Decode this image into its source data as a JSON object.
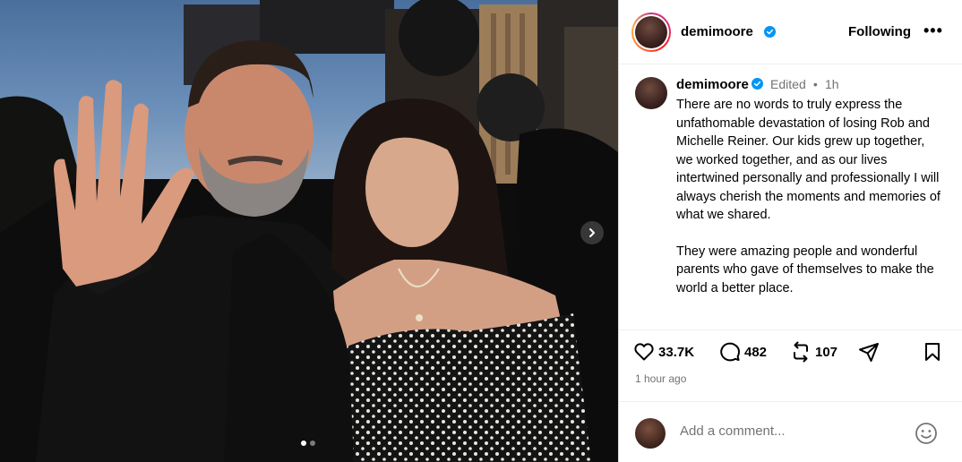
{
  "post": {
    "username": "demimoore",
    "follow_label": "Following",
    "more_label": "•••",
    "edited_label": "Edited",
    "separator": "•",
    "age_short": "1h",
    "caption_paragraphs": [
      "There are no words to truly express the unfathomable devastation of losing Rob and Michelle Reiner. Our kids grew up together, we worked together, and as our lives intertwined personally and professionally I will always cherish the moments and memories of what we shared.",
      "They were amazing people and wonderful parents who gave of themselves to make the world a better place."
    ],
    "likes": "33.7K",
    "comments": "482",
    "reposts": "107",
    "time_ago": "1 hour ago",
    "comment_placeholder": "Add a comment..."
  },
  "carousel": {
    "current": 1,
    "total": 2
  },
  "colors": {
    "verified": "#0095f6",
    "muted": "#737373"
  }
}
